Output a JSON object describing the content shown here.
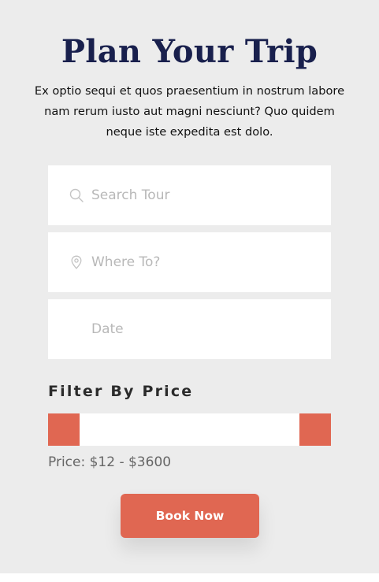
{
  "header": {
    "title": "Plan Your Trip",
    "description": "Ex optio sequi et quos praesentium in nostrum labore nam rerum iusto aut magni nesciunt? Quo quidem neque iste expedita est dolo."
  },
  "form": {
    "search": {
      "placeholder": "Search Tour",
      "value": "",
      "icon": "search-icon"
    },
    "destination": {
      "placeholder": "Where To?",
      "value": "",
      "icon": "location-pin-icon"
    },
    "date": {
      "placeholder": "Date",
      "value": ""
    }
  },
  "filter": {
    "title": "Filter By Price",
    "price_text": "Price: $12 - $3600",
    "min_price": 12,
    "max_price": 3600
  },
  "actions": {
    "book_label": "Book Now"
  },
  "colors": {
    "accent": "#e06752",
    "title": "#19204d",
    "panel_background": "#ececec"
  }
}
